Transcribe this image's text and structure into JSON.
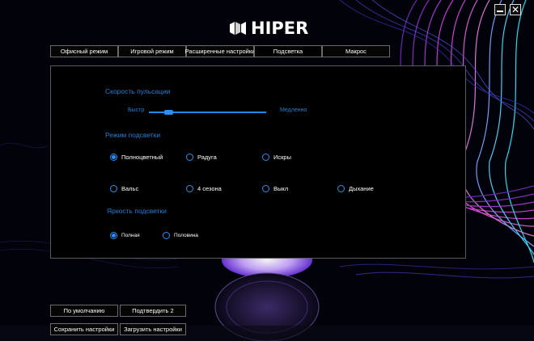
{
  "brand": {
    "name": "HIPER"
  },
  "window": {
    "minimize_icon": "minimize-icon",
    "close_icon": "close-icon"
  },
  "tabs": [
    {
      "label": "Офисный режим",
      "active": false
    },
    {
      "label": "Игровой режим",
      "active": false
    },
    {
      "label": "Расширенные настройки",
      "active": false
    },
    {
      "label": "Подсветка",
      "active": true
    },
    {
      "label": "Макрос",
      "active": false
    }
  ],
  "pulse": {
    "title": "Скорость пульсации",
    "left_label": "Быстр",
    "right_label": "Медленно",
    "value_fraction": 0.17
  },
  "mode": {
    "title": "Режим подсветки",
    "options": [
      {
        "label": "Полноцветный",
        "selected": true
      },
      {
        "label": "Радуга",
        "selected": false
      },
      {
        "label": "Искры",
        "selected": false
      },
      {
        "label": "Вальс",
        "selected": false
      },
      {
        "label": "4 сезона",
        "selected": false
      },
      {
        "label": "Выкл",
        "selected": false
      },
      {
        "label": "Дыхание",
        "selected": false
      }
    ]
  },
  "brightness": {
    "title": "Яркость подсветки",
    "options": [
      {
        "label": "Полная",
        "selected": true
      },
      {
        "label": "Половина",
        "selected": false
      }
    ]
  },
  "buttons": {
    "default": "По умолчанию",
    "confirm": "Подтвердить 2",
    "save": "Сохранить настройки",
    "load": "Загрузить настройки"
  },
  "colors": {
    "accent": "#2a8ff0",
    "section_title": "#1f7fd6",
    "wave_pink": "#d23ad6",
    "wave_cyan": "#22e4ff",
    "wave_purple": "#6a34d8"
  }
}
